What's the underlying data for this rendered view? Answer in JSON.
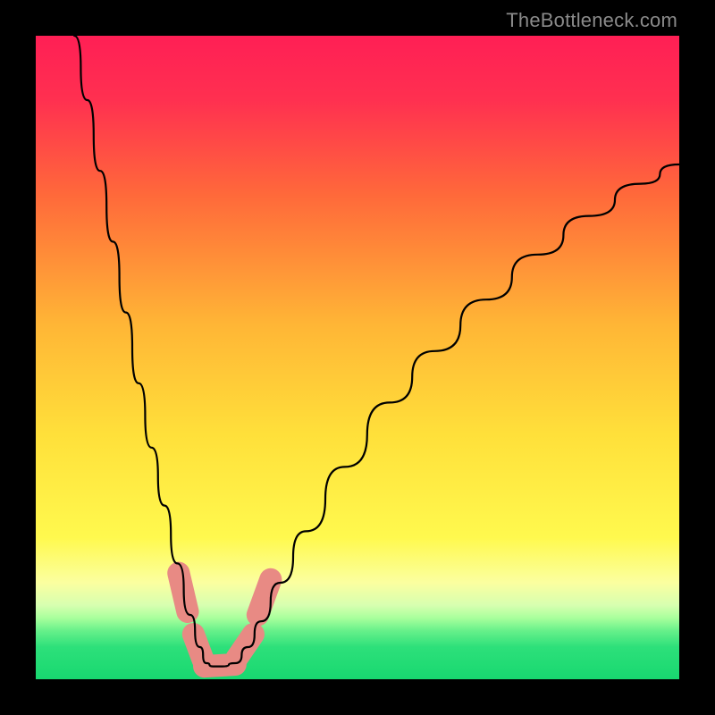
{
  "watermark": "TheBottleneck.com",
  "chart_data": {
    "type": "line",
    "title": "",
    "xlabel": "",
    "ylabel": "",
    "xlim": [
      0,
      100
    ],
    "ylim": [
      0,
      100
    ],
    "background_gradient_stops": [
      {
        "pos": 0.0,
        "color": "#ff1f55"
      },
      {
        "pos": 0.1,
        "color": "#ff3050"
      },
      {
        "pos": 0.25,
        "color": "#ff6a3a"
      },
      {
        "pos": 0.45,
        "color": "#ffb636"
      },
      {
        "pos": 0.62,
        "color": "#ffe03a"
      },
      {
        "pos": 0.78,
        "color": "#fff94e"
      },
      {
        "pos": 0.85,
        "color": "#fbffa0"
      },
      {
        "pos": 0.885,
        "color": "#d7ffb0"
      },
      {
        "pos": 0.905,
        "color": "#a8ff9c"
      },
      {
        "pos": 0.925,
        "color": "#66f08a"
      },
      {
        "pos": 0.95,
        "color": "#2de07a"
      },
      {
        "pos": 1.0,
        "color": "#18d870"
      }
    ],
    "series": [
      {
        "name": "bottleneck-curve",
        "color": "#000000",
        "x": [
          6,
          8,
          10,
          12,
          14,
          16,
          18,
          20,
          22,
          24,
          25.5,
          26.5,
          27.5,
          29,
          31,
          33,
          35,
          38,
          42,
          48,
          55,
          62,
          70,
          78,
          86,
          94,
          100
        ],
        "y": [
          100,
          90,
          79,
          68,
          57,
          46,
          36,
          27,
          18,
          10,
          5,
          2.5,
          2,
          2,
          2.5,
          5,
          9,
          15,
          23,
          33,
          43,
          51,
          59,
          66,
          72,
          77,
          80
        ]
      }
    ],
    "highlight_segments": [
      {
        "x": [
          22.2,
          23.6
        ],
        "y": [
          16.5,
          10.5
        ],
        "width": 3.5
      },
      {
        "x": [
          24.5,
          26.0
        ],
        "y": [
          7.0,
          3.0
        ],
        "width": 3.5
      },
      {
        "x": [
          26.2,
          31.0
        ],
        "y": [
          2.0,
          2.3
        ],
        "width": 3.5
      },
      {
        "x": [
          31.2,
          33.8
        ],
        "y": [
          3.2,
          7.0
        ],
        "width": 3.5
      },
      {
        "x": [
          34.5,
          36.5
        ],
        "y": [
          10.0,
          15.5
        ],
        "width": 3.5
      }
    ]
  }
}
